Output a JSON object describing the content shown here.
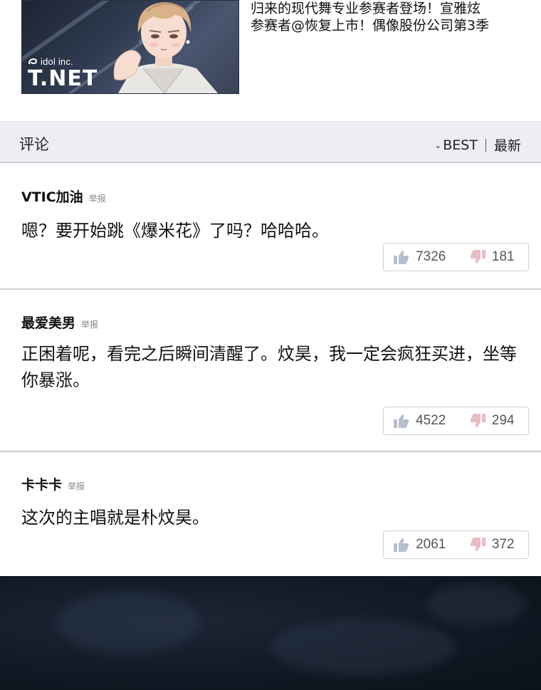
{
  "article": {
    "thumbnail": {
      "brand_small": "idol inc.",
      "brand_big": "T.NET"
    },
    "headline_line1": "归来的现代舞专业参赛者登场！宣雅炫",
    "headline_line2": "参赛者@恢复上市！偶像股份公司第3季"
  },
  "comments_header": {
    "title": "评论",
    "sort_best": "BEST",
    "sort_latest": "最新"
  },
  "comments": [
    {
      "user": "VTIC加油",
      "report": "举报",
      "text": "嗯？要开始跳《爆米花》了吗？哈哈哈。",
      "likes": "7326",
      "dislikes": "181"
    },
    {
      "user": "最爱美男",
      "report": "举报",
      "text": "正困着呢，看完之后瞬间清醒了。炆昊，我一定会疯狂买进，坐等你暴涨。",
      "likes": "4522",
      "dislikes": "294"
    },
    {
      "user": "卡卡卡",
      "report": "举报",
      "text": "这次的主唱就是朴炆昊。",
      "likes": "2061",
      "dislikes": "372"
    }
  ],
  "colors": {
    "like_icon": "#b6bfcc",
    "dislike_icon": "#e7bcc3",
    "header_bg": "#eceef3",
    "dark_panel": "#121a26"
  },
  "icons": {
    "like": "thumbs-up-icon",
    "dislike": "thumbs-down-icon",
    "sort": "chevron-down-icon"
  }
}
